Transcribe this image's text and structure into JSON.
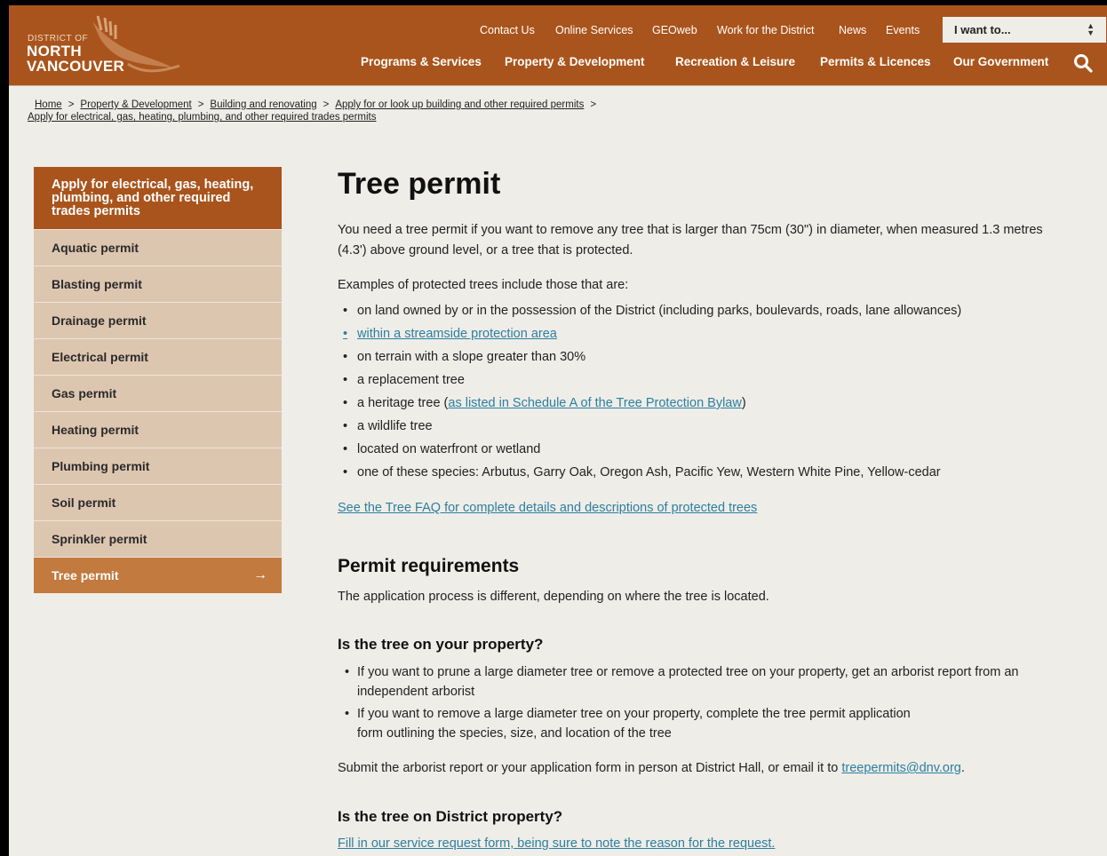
{
  "header": {
    "logo_small": "DISTRICT OF",
    "logo_line1": "NORTH",
    "logo_line2": "VANCOUVER",
    "util_links": [
      "Contact Us",
      "Online Services",
      "GEOweb",
      "Work for the District",
      "News",
      "Events"
    ],
    "iwant_label": "I want to...",
    "main_nav": [
      "Programs & Services",
      "Property & Development",
      "Recreation & Leisure",
      "Permits & Licences",
      "Our Government"
    ]
  },
  "breadcrumb": {
    "items": [
      "Home",
      "Property & Development",
      "Building and renovating",
      "Apply for or look up building and other required permits"
    ],
    "current": "Apply for electrical, gas, heating, plumbing, and other required trades permits",
    "separator": ">"
  },
  "sidebar": {
    "heading": "Apply for electrical, gas, heating, plumbing, and other required trades permits",
    "items": [
      "Aquatic permit",
      "Blasting permit",
      "Drainage permit",
      "Electrical permit",
      "Gas permit",
      "Heating permit",
      "Plumbing permit",
      "Soil permit",
      "Sprinkler permit",
      "Tree permit"
    ],
    "active_arrow": "→"
  },
  "content": {
    "title": "Tree permit",
    "intro": "You need a tree permit if you want to remove any tree that is larger than 75cm (30\") in diameter, when measured 1.3 metres (4.3') above ground level, or a tree that is protected.",
    "examples_intro": "Examples of protected trees include those that are:",
    "examples": {
      "e1": "on land owned by or in the possession of the District (including parks, boulevards, roads, lane allowances)",
      "e2_link": "within a streamside protection area",
      "e3": "on terrain with a slope greater than 30%",
      "e4": "a replacement tree",
      "e5_pre": "a heritage tree (",
      "e5_link": "as listed in Schedule A of the Tree Protection Bylaw",
      "e5_post": ")",
      "e6": "a wildlife tree",
      "e7": "located on waterfront or wetland",
      "e8": "one of these species: Arbutus, Garry Oak, Oregon Ash, Pacific Yew, Western White Pine, Yellow-cedar"
    },
    "faq_link": "See the Tree FAQ for complete details and descriptions of protected trees",
    "req_heading": "Permit requirements",
    "req_text": "The application process is different, depending on where the tree is located.",
    "own_heading": "Is the tree on your property?",
    "own_b1": "If you want to prune a large diameter tree or remove a protected tree on your property, get an arborist report from an independent arborist",
    "own_b2_l1": "If you want to remove a large diameter tree on your property, complete the tree permit application",
    "own_b2_l2": "form outlining the species, size, and location of the tree",
    "submit_pre": "Submit the arborist report or your application form in person at District Hall, or email it to ",
    "submit_email": "treepermits@dnv.org",
    "submit_post": ".",
    "district_heading": "Is the tree on District property?",
    "district_link": "Fill in our service request form, being sure to note the reason for the request."
  },
  "colors": {
    "brand": "#a9541c",
    "sidebar_bg": "#ddc6b0",
    "active": "#c27a3e",
    "link": "#2b7fa0",
    "page_bg": "#efede8"
  },
  "icons": {
    "search": "search-icon",
    "logo_bird": "eagle-icon",
    "select_arrows": "sort-arrows-icon"
  }
}
